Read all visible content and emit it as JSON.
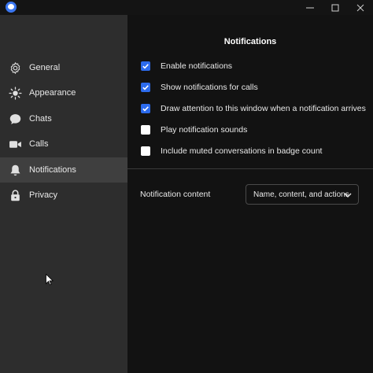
{
  "window": {
    "controls": [
      "minimize-icon",
      "maximize-icon",
      "close-icon"
    ]
  },
  "sidebar": {
    "items": [
      {
        "label": "General",
        "icon": "gear-icon"
      },
      {
        "label": "Appearance",
        "icon": "sun-icon"
      },
      {
        "label": "Chats",
        "icon": "chat-bubble-icon"
      },
      {
        "label": "Calls",
        "icon": "video-camera-icon"
      },
      {
        "label": "Notifications",
        "icon": "bell-icon",
        "active": true
      },
      {
        "label": "Privacy",
        "icon": "lock-icon"
      }
    ]
  },
  "main": {
    "title": "Notifications",
    "options": [
      {
        "label": "Enable notifications",
        "checked": true
      },
      {
        "label": "Show notifications for calls",
        "checked": true
      },
      {
        "label": "Draw attention to this window when a notification arrives",
        "checked": true
      },
      {
        "label": "Play notification sounds",
        "checked": false
      },
      {
        "label": "Include muted conversations in badge count",
        "checked": false
      }
    ],
    "notification_content": {
      "label": "Notification content",
      "value": "Name, content, and actions"
    }
  },
  "colors": {
    "accent": "#2c6bed",
    "sidebar_bg": "#2d2d2d",
    "sidebar_active": "#3f3f3f",
    "content_bg": "#121212"
  }
}
